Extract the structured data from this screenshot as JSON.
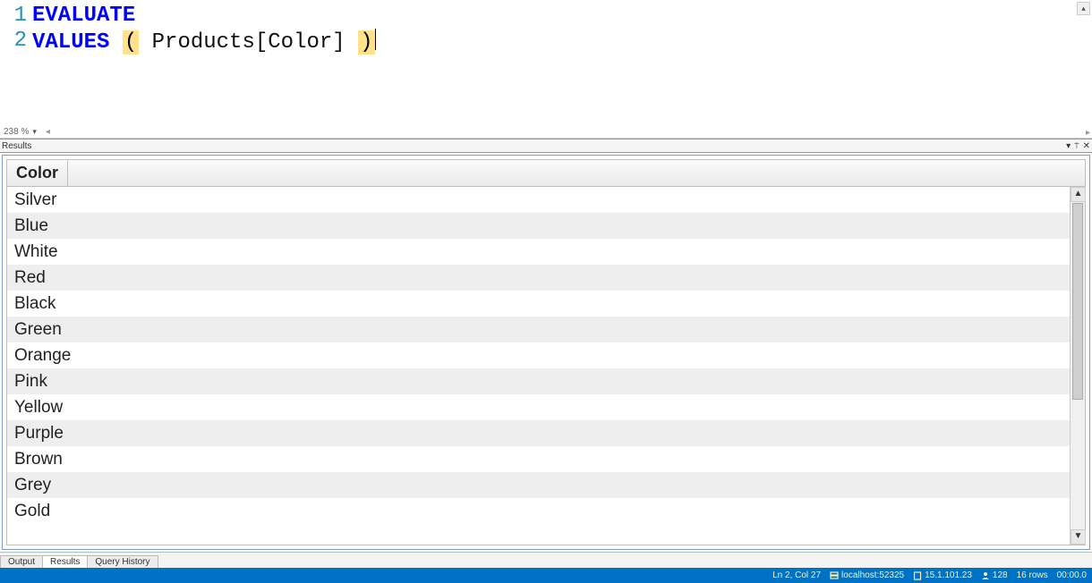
{
  "editor": {
    "lines": [
      {
        "num": "1",
        "tokens": [
          {
            "t": "kw",
            "v": "EVALUATE"
          }
        ]
      },
      {
        "num": "2",
        "tokens": [
          {
            "t": "kw",
            "v": "VALUES"
          },
          {
            "t": "sp",
            "v": " "
          },
          {
            "t": "paren",
            "v": "("
          },
          {
            "t": "sp",
            "v": " "
          },
          {
            "t": "ident",
            "v": "Products[Color]"
          },
          {
            "t": "sp",
            "v": " "
          },
          {
            "t": "paren",
            "v": ")"
          },
          {
            "t": "caret",
            "v": ""
          }
        ]
      }
    ],
    "zoom_label": "238 %",
    "scroll_left_glyph": "◂"
  },
  "results_pane": {
    "title": "Results",
    "dropdown_glyph": "▾",
    "pin_glyph": "📌",
    "close_glyph": "✕"
  },
  "grid": {
    "column_header": "Color",
    "rows": [
      "Silver",
      "Blue",
      "White",
      "Red",
      "Black",
      "Green",
      "Orange",
      "Pink",
      "Yellow",
      "Purple",
      "Brown",
      "Grey",
      "Gold"
    ],
    "scroll_up_glyph": "▲",
    "scroll_down_glyph": "▼"
  },
  "tabs": {
    "items": [
      "Output",
      "Results",
      "Query History"
    ],
    "active_index": 1
  },
  "status": {
    "position": "Ln 2, Col 27",
    "server": "localhost:52325",
    "version": "15.1.101.23",
    "spid": "128",
    "rows": "16 rows",
    "elapsed": "00:00.0"
  }
}
